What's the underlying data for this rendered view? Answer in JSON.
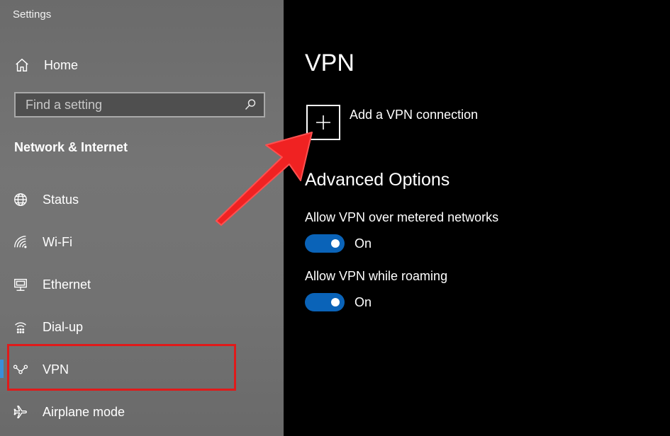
{
  "app": {
    "title": "Settings"
  },
  "sidebar": {
    "home_label": "Home",
    "search_placeholder": "Find a setting",
    "section_title": "Network & Internet",
    "items": [
      {
        "label": "Status",
        "icon": "globe-icon"
      },
      {
        "label": "Wi-Fi",
        "icon": "wifi-icon"
      },
      {
        "label": "Ethernet",
        "icon": "ethernet-icon"
      },
      {
        "label": "Dial-up",
        "icon": "dial-up-icon"
      },
      {
        "label": "VPN",
        "icon": "vpn-icon",
        "active": true
      },
      {
        "label": "Airplane mode",
        "icon": "airplane-icon"
      }
    ]
  },
  "main": {
    "title": "VPN",
    "add_label": "Add a VPN connection",
    "advanced_title": "Advanced Options",
    "options": [
      {
        "label": "Allow VPN over metered networks",
        "state": "On",
        "on": true
      },
      {
        "label": "Allow VPN while roaming",
        "state": "On",
        "on": true
      }
    ]
  },
  "colors": {
    "accent": "#0a63b8",
    "highlight": "#e01a1a",
    "arrow": "#f02222",
    "active_indicator": "#3a8fd9"
  }
}
